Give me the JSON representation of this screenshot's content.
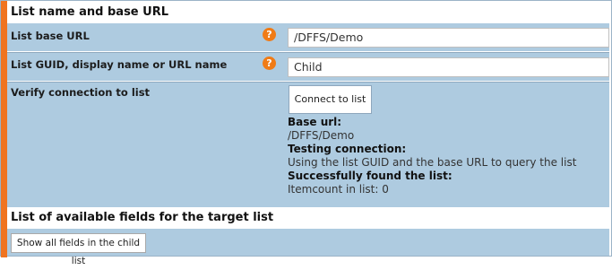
{
  "section1": {
    "title": "List name and base URL"
  },
  "base_url_row": {
    "label": "List base URL",
    "help_icon": "question-mark",
    "value": "/DFFS/Demo"
  },
  "guid_row": {
    "label": "List GUID, display name or URL name",
    "help_icon": "question-mark",
    "value": "Child"
  },
  "verify_row": {
    "label": "Verify connection to list",
    "button_label": "Connect to list",
    "result": {
      "base_url_heading": "Base url:",
      "base_url_value": "/DFFS/Demo",
      "testing_heading": "Testing connection:",
      "testing_text": "Using the list GUID and the base URL to query the list",
      "found_heading": "Successfully found the list:",
      "itemcount_text": "Itemcount in list: 0"
    }
  },
  "section2": {
    "title": "List of available fields for the target list",
    "button_label": "Show all fields in the child list"
  },
  "colors": {
    "accent": "#f07420",
    "row_background": "#aecbe0",
    "help_icon": "#f07b16"
  }
}
